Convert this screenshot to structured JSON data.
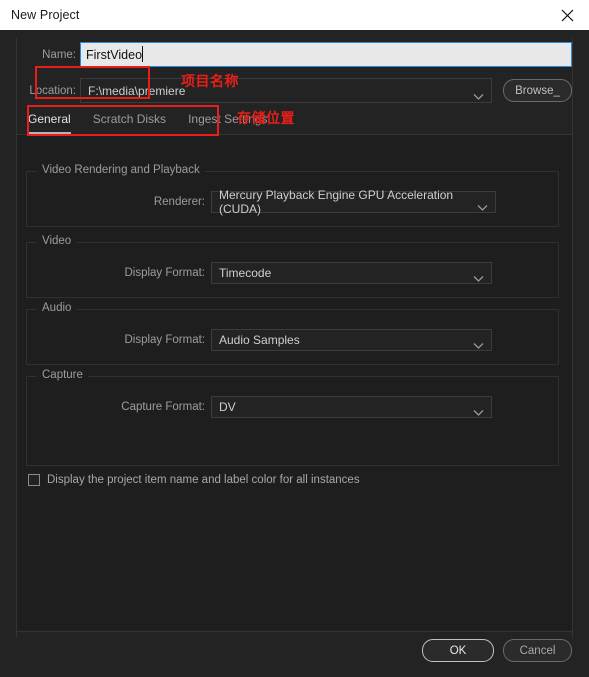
{
  "window": {
    "title": "New Project",
    "close_icon": "close-icon"
  },
  "fields": {
    "name_label": "Name:",
    "name_value": "FirstVideo",
    "location_label": "Location:",
    "location_value": "F:\\media\\premiere",
    "browse_label": "Browse_"
  },
  "tabs": [
    {
      "label": "General",
      "active": true
    },
    {
      "label": "Scratch Disks",
      "active": false
    },
    {
      "label": "Ingest Settings",
      "active": false
    }
  ],
  "groups": {
    "video_rendering": {
      "title": "Video Rendering and Playback",
      "renderer_label": "Renderer:",
      "renderer_value": "Mercury Playback Engine GPU Acceleration (CUDA)"
    },
    "video": {
      "title": "Video",
      "display_format_label": "Display Format:",
      "display_format_value": "Timecode"
    },
    "audio": {
      "title": "Audio",
      "display_format_label": "Display Format:",
      "display_format_value": "Audio Samples"
    },
    "capture": {
      "title": "Capture",
      "capture_format_label": "Capture Format:",
      "capture_format_value": "DV"
    }
  },
  "checkbox": {
    "label": "Display the project item name and label color for all instances",
    "checked": false
  },
  "footer": {
    "ok_label": "OK",
    "cancel_label": "Cancel"
  },
  "annotations": [
    {
      "text": "项目名称",
      "color": "#e81f18"
    },
    {
      "text": "存储位置",
      "color": "#e81f18"
    }
  ],
  "colors": {
    "dialog_bg": "#232323",
    "panel_bg": "#1e1e1e",
    "titlebar_bg": "#ffffff",
    "focus_border": "#2a8ae0",
    "annotation_red": "#e81f18"
  }
}
